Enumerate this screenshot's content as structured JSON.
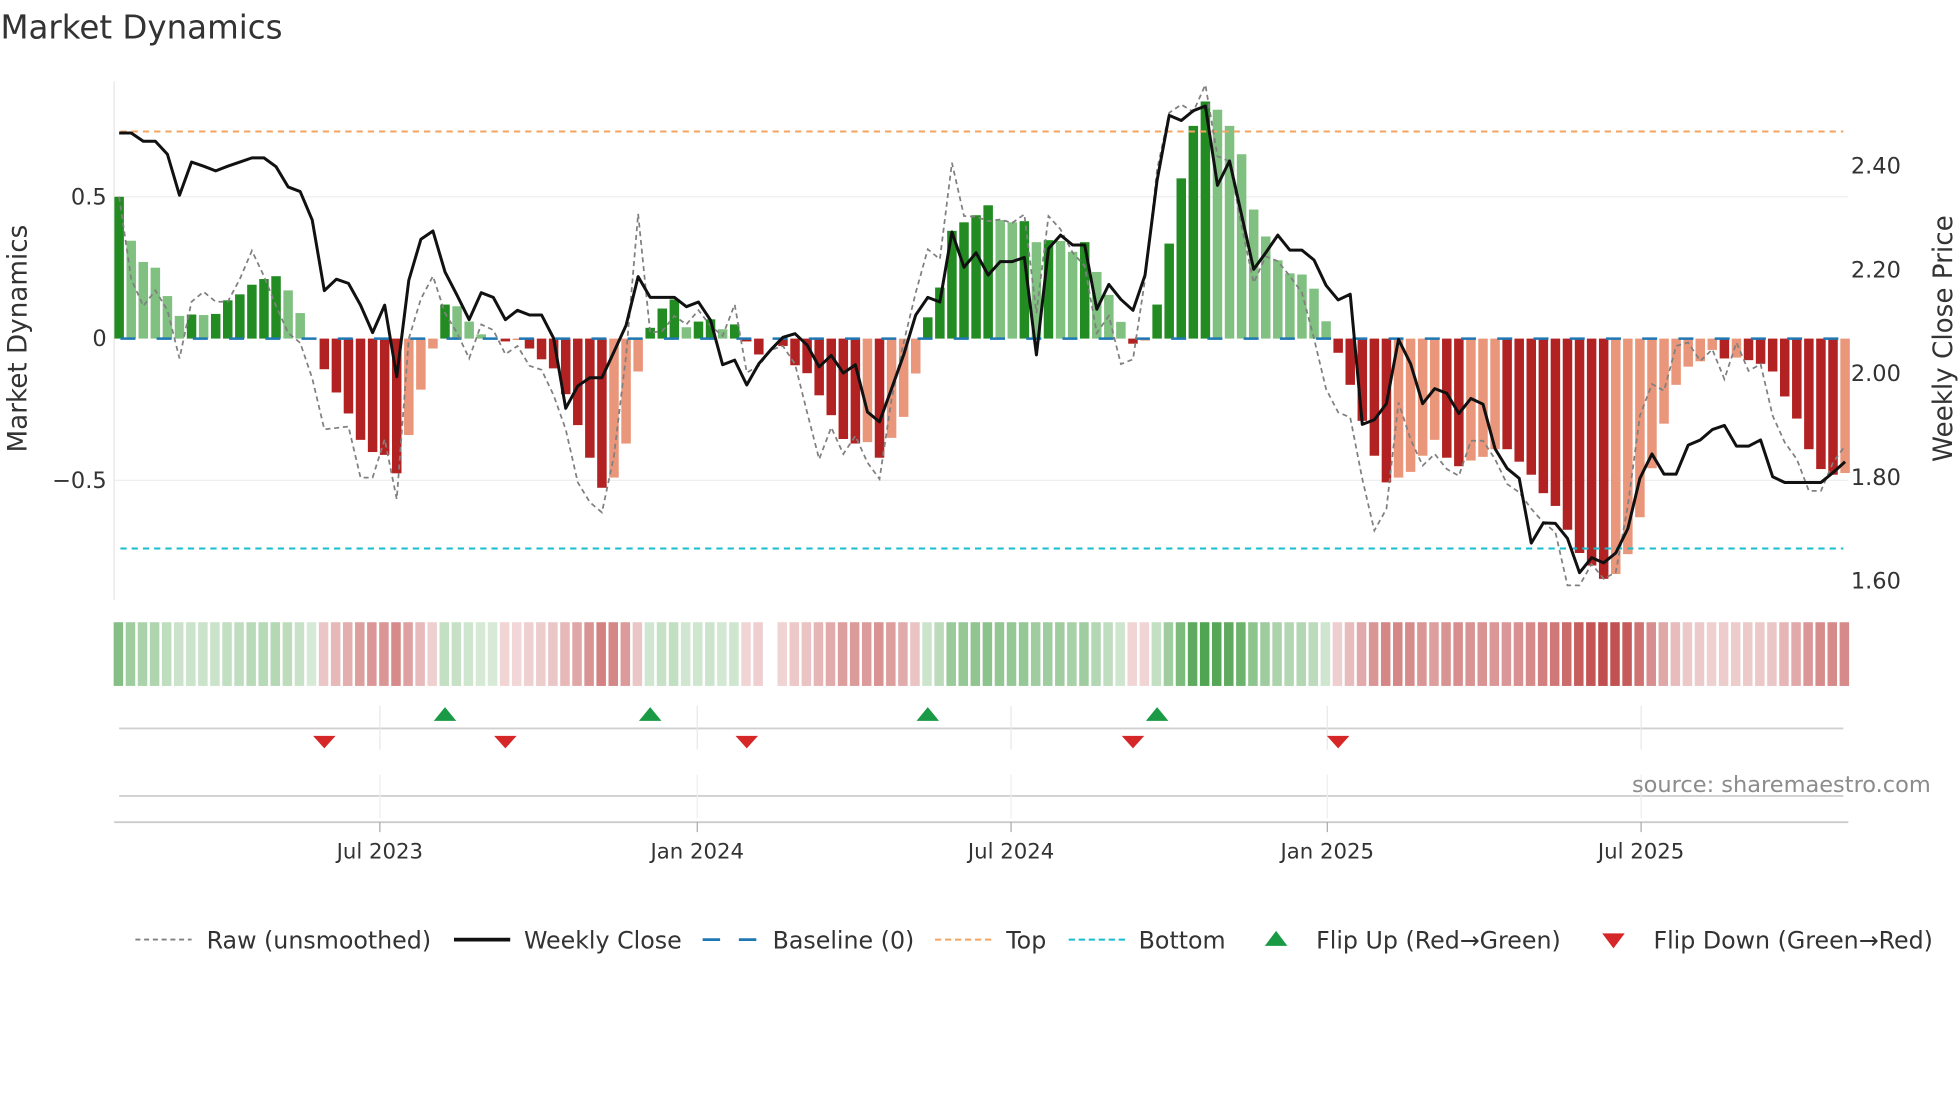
{
  "chart_data": {
    "type": "bar",
    "title": "Market Dynamics",
    "ylabel": "Market Dynamics",
    "y2label": "Weekly Close Price",
    "ylim": [
      -0.92,
      0.9
    ],
    "y2lim": [
      1.57,
      2.56
    ],
    "yticks": [
      {
        "v": 0.5,
        "label": "0.5"
      },
      {
        "v": 0,
        "label": "0"
      },
      {
        "v": -0.5,
        "label": "−0.5"
      }
    ],
    "y2ticks": [
      {
        "v": 2.4,
        "label": "2.40"
      },
      {
        "v": 2.2,
        "label": "2.20"
      },
      {
        "v": 2.0,
        "label": "2.00"
      },
      {
        "v": 1.8,
        "label": "1.80"
      },
      {
        "v": 1.6,
        "label": "1.60"
      }
    ],
    "xticks": [
      {
        "week": 21.6,
        "label": "Jul 2023"
      },
      {
        "week": 47.9,
        "label": "Jan 2024"
      },
      {
        "week": 73.9,
        "label": "Jul 2024"
      },
      {
        "week": 100.1,
        "label": "Jan 2025"
      },
      {
        "week": 126.1,
        "label": "Jul 2025"
      }
    ],
    "top": 0.73,
    "bottom": -0.74,
    "baseline": 0,
    "values": [
      0.5,
      0.345,
      0.27,
      0.25,
      0.15,
      0.08,
      0.085,
      0.083,
      0.087,
      0.135,
      0.156,
      0.19,
      0.21,
      0.22,
      0.17,
      0.09,
      0.0,
      -0.108,
      -0.19,
      -0.264,
      -0.357,
      -0.4,
      -0.41,
      -0.475,
      -0.34,
      -0.18,
      -0.035,
      0.12,
      0.114,
      0.06,
      0.015,
      0.0,
      -0.01,
      -0.005,
      -0.035,
      -0.073,
      -0.105,
      -0.196,
      -0.305,
      -0.42,
      -0.526,
      -0.49,
      -0.37,
      -0.116,
      0.038,
      0.106,
      0.138,
      0.04,
      0.06,
      0.068,
      0.033,
      0.05,
      -0.01,
      -0.056,
      0.0,
      -0.026,
      -0.094,
      -0.122,
      -0.2,
      -0.27,
      -0.354,
      -0.37,
      -0.365,
      -0.42,
      -0.35,
      -0.276,
      -0.123,
      0.075,
      0.18,
      0.38,
      0.41,
      0.435,
      0.47,
      0.418,
      0.41,
      0.414,
      0.34,
      0.347,
      0.344,
      0.306,
      0.34,
      0.235,
      0.154,
      0.059,
      -0.018,
      -0.007,
      0.12,
      0.335,
      0.565,
      0.75,
      0.836,
      0.807,
      0.75,
      0.65,
      0.455,
      0.36,
      0.276,
      0.23,
      0.226,
      0.176,
      0.061,
      -0.05,
      -0.163,
      -0.29,
      -0.413,
      -0.507,
      -0.49,
      -0.47,
      -0.413,
      -0.357,
      -0.42,
      -0.45,
      -0.43,
      -0.417,
      -0.39,
      -0.39,
      -0.434,
      -0.48,
      -0.545,
      -0.59,
      -0.674,
      -0.756,
      -0.8,
      -0.847,
      -0.83,
      -0.76,
      -0.63,
      -0.457,
      -0.3,
      -0.163,
      -0.099,
      -0.08,
      -0.04,
      -0.07,
      -0.067,
      -0.076,
      -0.089,
      -0.116,
      -0.204,
      -0.282,
      -0.39,
      -0.46,
      -0.48,
      -0.474
    ],
    "raw": [
      0.5,
      0.21,
      0.115,
      0.17,
      0.1,
      -0.07,
      0.13,
      0.165,
      0.13,
      0.13,
      0.21,
      0.31,
      0.22,
      0.115,
      0.02,
      -0.015,
      -0.14,
      -0.32,
      -0.315,
      -0.31,
      -0.49,
      -0.49,
      -0.355,
      -0.566,
      0,
      0.14,
      0.22,
      0.09,
      0.02,
      -0.07,
      0.05,
      0.03,
      -0.055,
      -0.026,
      -0.096,
      -0.11,
      -0.2,
      -0.32,
      -0.507,
      -0.577,
      -0.613,
      -0.413,
      -0.06,
      0.44,
      0.02,
      0.027,
      0.08,
      0.05,
      0.1,
      0.045,
      0.01,
      0.12,
      -0.12,
      -0.096,
      -0.04,
      -0.026,
      -0.09,
      -0.26,
      -0.425,
      -0.313,
      -0.407,
      -0.343,
      -0.437,
      -0.495,
      -0.214,
      -0.014,
      0.162,
      0.315,
      0.28,
      0.62,
      0.432,
      0.43,
      0.414,
      0.42,
      0.408,
      0.438,
      0.09,
      0.432,
      0.385,
      0.303,
      0.256,
      0.02,
      0.08,
      -0.09,
      -0.073,
      0.209,
      0.596,
      0.796,
      0.825,
      0.8,
      0.895,
      0.643,
      0.625,
      0.396,
      0.197,
      0.29,
      0.273,
      0.22,
      0.162,
      0,
      -0.178,
      -0.26,
      -0.278,
      -0.495,
      -0.677,
      -0.6,
      -0.225,
      -0.355,
      -0.448,
      -0.407,
      -0.46,
      -0.484,
      -0.36,
      -0.36,
      -0.425,
      -0.513,
      -0.542,
      -0.6,
      -0.648,
      -0.683,
      -0.87,
      -0.87,
      -0.795,
      -0.847,
      -0.824,
      -0.59,
      -0.272,
      -0.16,
      -0.184,
      -0.026,
      -0.014,
      -0.079,
      -0.038,
      -0.143,
      -0.014,
      -0.114,
      -0.09,
      -0.272,
      -0.366,
      -0.425,
      -0.537,
      -0.537,
      -0.437,
      -0.378
    ],
    "close": [
      2.464,
      2.464,
      2.448,
      2.448,
      2.423,
      2.344,
      2.408,
      2.4,
      2.391,
      2.4,
      2.408,
      2.416,
      2.416,
      2.399,
      2.36,
      2.351,
      2.296,
      2.16,
      2.182,
      2.174,
      2.132,
      2.079,
      2.132,
      1.994,
      2.18,
      2.259,
      2.275,
      2.196,
      2.151,
      2.104,
      2.156,
      2.147,
      2.104,
      2.122,
      2.113,
      2.113,
      2.068,
      1.933,
      1.976,
      1.992,
      1.992,
      2.042,
      2.093,
      2.187,
      2.147,
      2.147,
      2.147,
      2.129,
      2.138,
      2.103,
      2.017,
      2.026,
      1.978,
      2.019,
      2.046,
      2.07,
      2.077,
      2.055,
      2.013,
      2.035,
      2.001,
      2.017,
      1.926,
      1.907,
      1.971,
      2.036,
      2.113,
      2.147,
      2.138,
      2.273,
      2.205,
      2.233,
      2.19,
      2.216,
      2.216,
      2.224,
      2.036,
      2.241,
      2.267,
      2.248,
      2.248,
      2.124,
      2.172,
      2.143,
      2.122,
      2.19,
      2.373,
      2.498,
      2.488,
      2.507,
      2.516,
      2.363,
      2.41,
      2.306,
      2.201,
      2.233,
      2.267,
      2.238,
      2.238,
      2.219,
      2.17,
      2.142,
      2.153,
      1.902,
      1.911,
      1.942,
      2.066,
      2.019,
      1.942,
      1.971,
      1.962,
      1.923,
      1.952,
      1.941,
      1.855,
      1.817,
      1.798,
      1.673,
      1.712,
      1.711,
      1.682,
      1.616,
      1.645,
      1.635,
      1.654,
      1.701,
      1.798,
      1.845,
      1.806,
      1.806,
      1.862,
      1.872,
      1.892,
      1.9,
      1.86,
      1.86,
      1.872,
      1.801,
      1.79,
      1.79,
      1.79,
      1.79,
      1.809,
      1.83
    ],
    "flip_up_weeks": [
      27,
      44,
      67,
      86
    ],
    "flip_down_weeks": [
      17,
      32,
      52,
      84,
      101
    ],
    "legend": {
      "placement": "bottom",
      "items": [
        {
          "key": "raw",
          "label": "Raw (unsmoothed)"
        },
        {
          "key": "close",
          "label": "Weekly Close"
        },
        {
          "key": "baseline",
          "label": "Baseline (0)"
        },
        {
          "key": "top",
          "label": "Top"
        },
        {
          "key": "bottom",
          "label": "Bottom"
        },
        {
          "key": "flip_up",
          "label": "Flip Up (Red→Green)"
        },
        {
          "key": "flip_down",
          "label": "Flip Down (Green→Red)"
        }
      ]
    },
    "source": "source: sharemaestro.com",
    "colors": {
      "pos_strong": "#228b22",
      "pos_weak": "#80c080",
      "neg_strong": "#b22222",
      "neg_weak": "#e9967a",
      "close": "#111111",
      "raw": "#808080",
      "baseline": "#1f77b4",
      "top": "#f4a460",
      "bottom": "#17becf",
      "flip_up": "#1a9a45",
      "flip_down": "#d62728"
    }
  }
}
